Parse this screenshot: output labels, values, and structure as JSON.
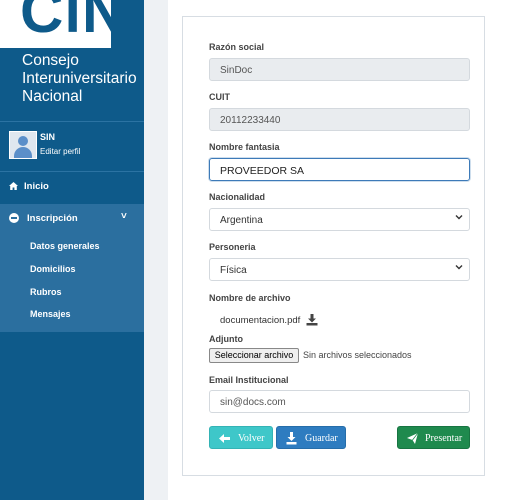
{
  "sidebar": {
    "logo_word": "CiN",
    "logo_lines": [
      "Consejo",
      "Interuniversitario",
      "Nacional"
    ],
    "profile": {
      "name": "SIN",
      "link": "Editar perfil"
    },
    "nav": {
      "inicio": {
        "label": "Inicio",
        "icon": "home-icon"
      },
      "inscripcion": {
        "label": "Inscripción",
        "icon": "globe-icon",
        "chevron": "˅",
        "items": [
          "Datos generales",
          "Domicilios",
          "Rubros",
          "Mensajes"
        ]
      }
    }
  },
  "form": {
    "razon_social": {
      "label": "Razón social",
      "value": "SinDoc"
    },
    "cuit": {
      "label": "CUIT",
      "value": "20112233440"
    },
    "nombre_fantasia": {
      "label": "Nombre fantasia",
      "value": "PROVEEDOR SA"
    },
    "nacionalidad": {
      "label": "Nacionalidad",
      "value": "Argentina"
    },
    "personeria": {
      "label": "Personeria",
      "value": "Física"
    },
    "archivo": {
      "label": "Nombre de archivo",
      "filename": "documentacion.pdf"
    },
    "adjunto": {
      "label": "Adjunto",
      "button": "Seleccionar archivo",
      "status": "Sin archivos seleccionados"
    },
    "email": {
      "label": "Email Institucional",
      "value": "sin@docs.com"
    },
    "buttons": {
      "volver": {
        "label": "Volver",
        "icon": "arrow-left-icon"
      },
      "guardar": {
        "label": "Guardar",
        "icon": "download-icon"
      },
      "presentar": {
        "label": "Presentar",
        "icon": "send-icon"
      }
    }
  },
  "colors": {
    "sidebar": "#0e5a8a",
    "sidebar_active": "#2b6f9f",
    "volver": "#3ec7c9",
    "guardar": "#2e7cc0",
    "presentar": "#1f8a4e"
  }
}
